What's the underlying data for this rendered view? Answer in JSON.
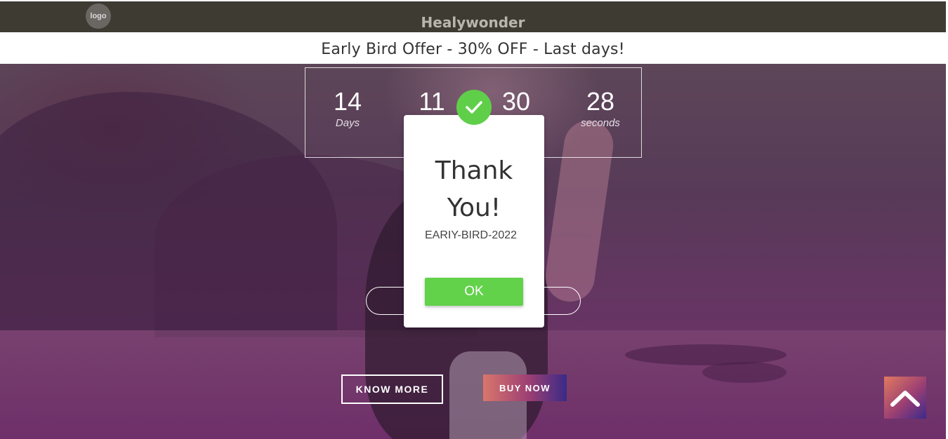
{
  "header": {
    "logo_text": "logo",
    "brand": "Healywonder"
  },
  "offer": {
    "text": "Early Bird Offer - 30% OFF - Last days!"
  },
  "countdown": {
    "days": {
      "value": "14",
      "label": "Days"
    },
    "hours": {
      "value": "11"
    },
    "minutes": {
      "value": "30"
    },
    "seconds": {
      "value": "28",
      "label": "seconds"
    }
  },
  "cta": {
    "know_more": "KNOW MORE",
    "buy_now": "BUY NOW"
  },
  "modal": {
    "title": "Thank You!",
    "code": "EARIY-BIRD-2022",
    "ok_label": "OK"
  },
  "icons": {
    "check": "check-icon",
    "scroll_top": "chevron-up-icon"
  },
  "colors": {
    "header_bg": "#3e3b33",
    "check_green": "#5fcf4a",
    "ok_green": "#62d24b",
    "hero_tint": "#6c2d68"
  }
}
